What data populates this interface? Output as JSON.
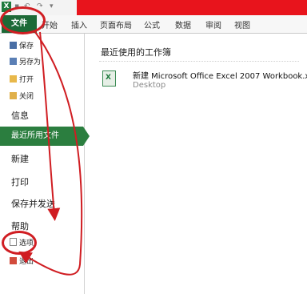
{
  "ribbon": {
    "tabs": [
      "开始",
      "插入",
      "页面布局",
      "公式",
      "数据",
      "审阅",
      "视图"
    ],
    "file_tab": "文件"
  },
  "left_menu": {
    "top_commands": [
      "保存",
      "另存为",
      "打开",
      "关闭"
    ],
    "info": "信息",
    "recent": "最近所用文件",
    "new": "新建",
    "print": "打印",
    "save_send": "保存并发送",
    "help": "帮助",
    "options": "选项",
    "exit": "退出"
  },
  "recent_panel": {
    "heading": "最近使用的工作簿",
    "files": [
      {
        "name": "新建 Microsoft Office Excel 2007 Workbook.xlsx",
        "path": "Desktop"
      }
    ]
  },
  "colors": {
    "file_tab": "#1d6a37",
    "accent_red": "#d01d22",
    "recent_bg": "#2b7e3f"
  }
}
